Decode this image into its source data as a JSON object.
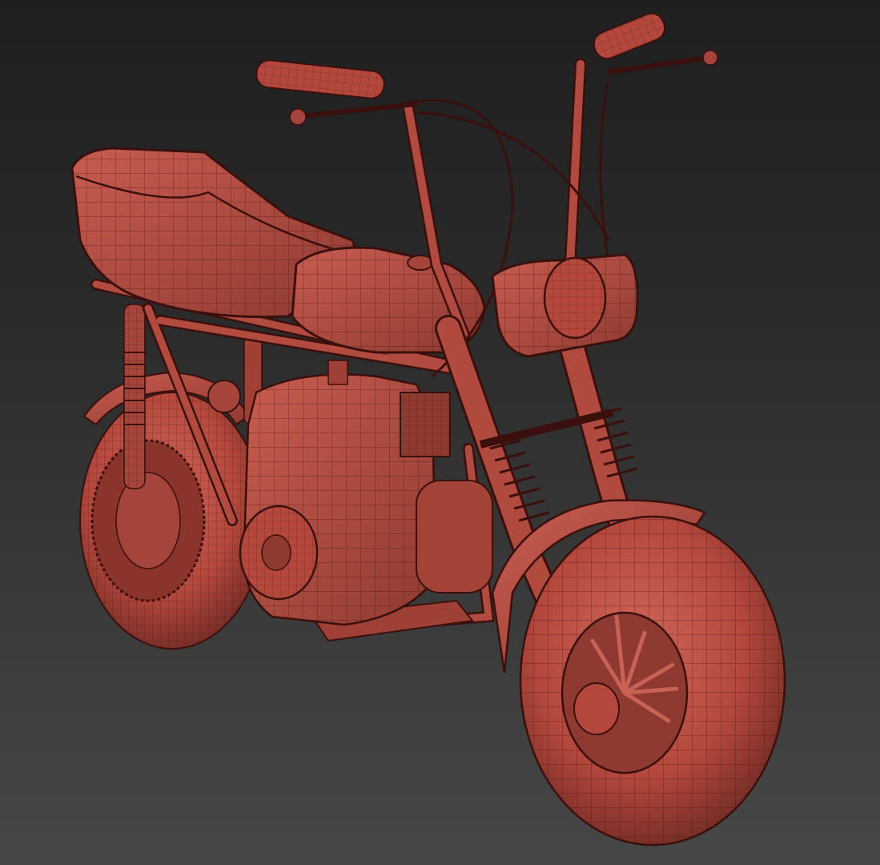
{
  "viewport": {
    "background_top": "#1f1f1f",
    "background_bottom": "#474747"
  },
  "model": {
    "subject": "minibike",
    "shading": "clay wireframe",
    "base_color": "#b5483d",
    "shadow_color": "#6e2a24",
    "highlight_color": "#d0675b",
    "wire_color": "#3a0f0c"
  }
}
